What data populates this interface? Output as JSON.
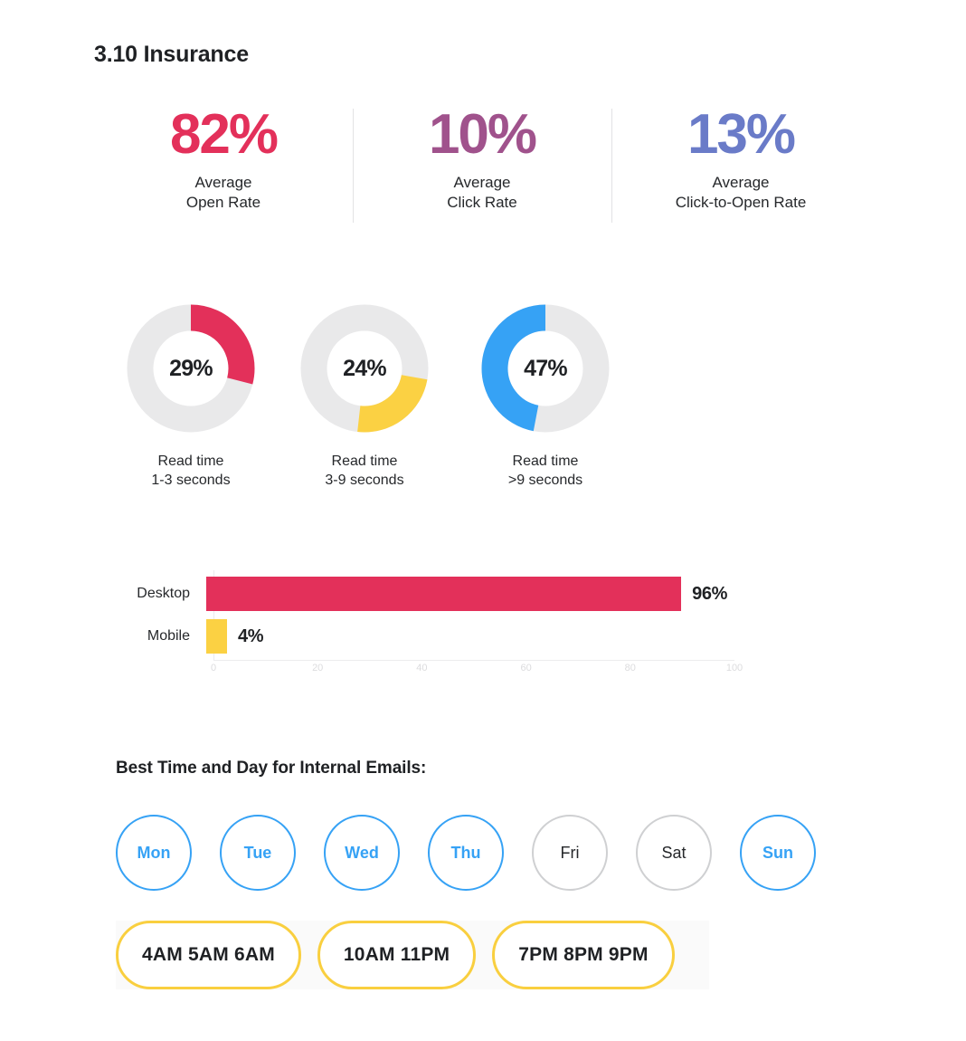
{
  "page": {
    "title": "3.10 Insurance"
  },
  "colors": {
    "crimson": "#E3305A",
    "purple": "#A0528C",
    "periwinkle": "#6A7BC8",
    "yellow": "#FBD143",
    "blue": "#36A2F5",
    "track_gray": "#E9E9EA",
    "ink": "#1F2124"
  },
  "kpis": [
    {
      "value": "82%",
      "line1": "Average",
      "line2": "Open Rate",
      "color": "#E3305A"
    },
    {
      "value": "10%",
      "line1": "Average",
      "line2": "Click Rate",
      "color": "#A0528C"
    },
    {
      "value": "13%",
      "line1": "Average",
      "line2": "Click-to-Open Rate",
      "color": "#6A7BC8"
    }
  ],
  "donuts": [
    {
      "value": 29,
      "value_label": "29%",
      "line1": "Read time",
      "line2": "1-3 seconds",
      "color": "#E3305A",
      "start_deg": 0,
      "direction": "cw"
    },
    {
      "value": 24,
      "value_label": "24%",
      "line1": "Read time",
      "line2": "3-9 seconds",
      "color": "#FBD143",
      "start_deg": 100,
      "direction": "cw"
    },
    {
      "value": 47,
      "value_label": "47%",
      "line1": "Read time",
      "line2": ">9 seconds",
      "color": "#36A2F5",
      "start_deg": 0,
      "direction": "ccw"
    }
  ],
  "device_chart": {
    "type": "bar",
    "orientation": "horizontal",
    "categories": [
      "Desktop",
      "Mobile"
    ],
    "values": [
      96,
      4
    ],
    "value_labels": [
      "96%",
      "4%"
    ],
    "colors": [
      "#E3305A",
      "#FBD143"
    ],
    "xlim": [
      0,
      100
    ],
    "ticks": [
      0,
      20,
      40,
      60,
      80,
      100
    ],
    "tick_labels": [
      "0",
      "20",
      "40",
      "60",
      "80",
      "100"
    ],
    "title": "",
    "xlabel": "",
    "ylabel": "",
    "grid": false
  },
  "best_time": {
    "heading": "Best Time and Day for Internal Emails:",
    "days": [
      {
        "label": "Mon",
        "active": true
      },
      {
        "label": "Tue",
        "active": true
      },
      {
        "label": "Wed",
        "active": true
      },
      {
        "label": "Thu",
        "active": true
      },
      {
        "label": "Fri",
        "active": false
      },
      {
        "label": "Sat",
        "active": false
      },
      {
        "label": "Sun",
        "active": true
      }
    ],
    "time_groups": [
      {
        "label": "4AM  5AM  6AM"
      },
      {
        "label": "10AM  11PM"
      },
      {
        "label": "7PM  8PM  9PM"
      }
    ]
  }
}
